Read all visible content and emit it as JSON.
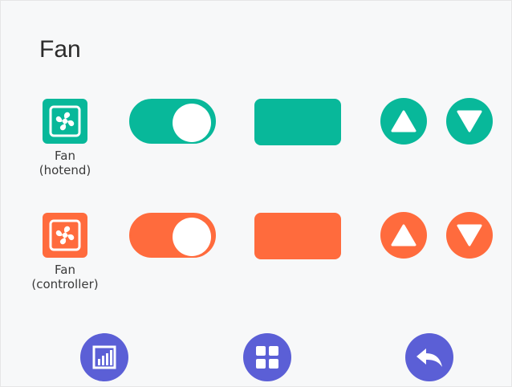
{
  "screen": {
    "title": "Fan"
  },
  "colors": {
    "hotend": "#08b89a",
    "controller": "#ff6b3d",
    "navigation": "#5b5fd6"
  },
  "fans": [
    {
      "label": "Fan\n(hotend)",
      "icon": "fan-icon",
      "toggle_state": "on",
      "value": ""
    },
    {
      "label": "Fan\n(controller)",
      "icon": "fan-icon",
      "toggle_state": "on",
      "value": ""
    }
  ],
  "bottom_nav": {
    "icons": [
      "bar-chart-icon",
      "grid-icon",
      "back-arrow-icon"
    ]
  }
}
